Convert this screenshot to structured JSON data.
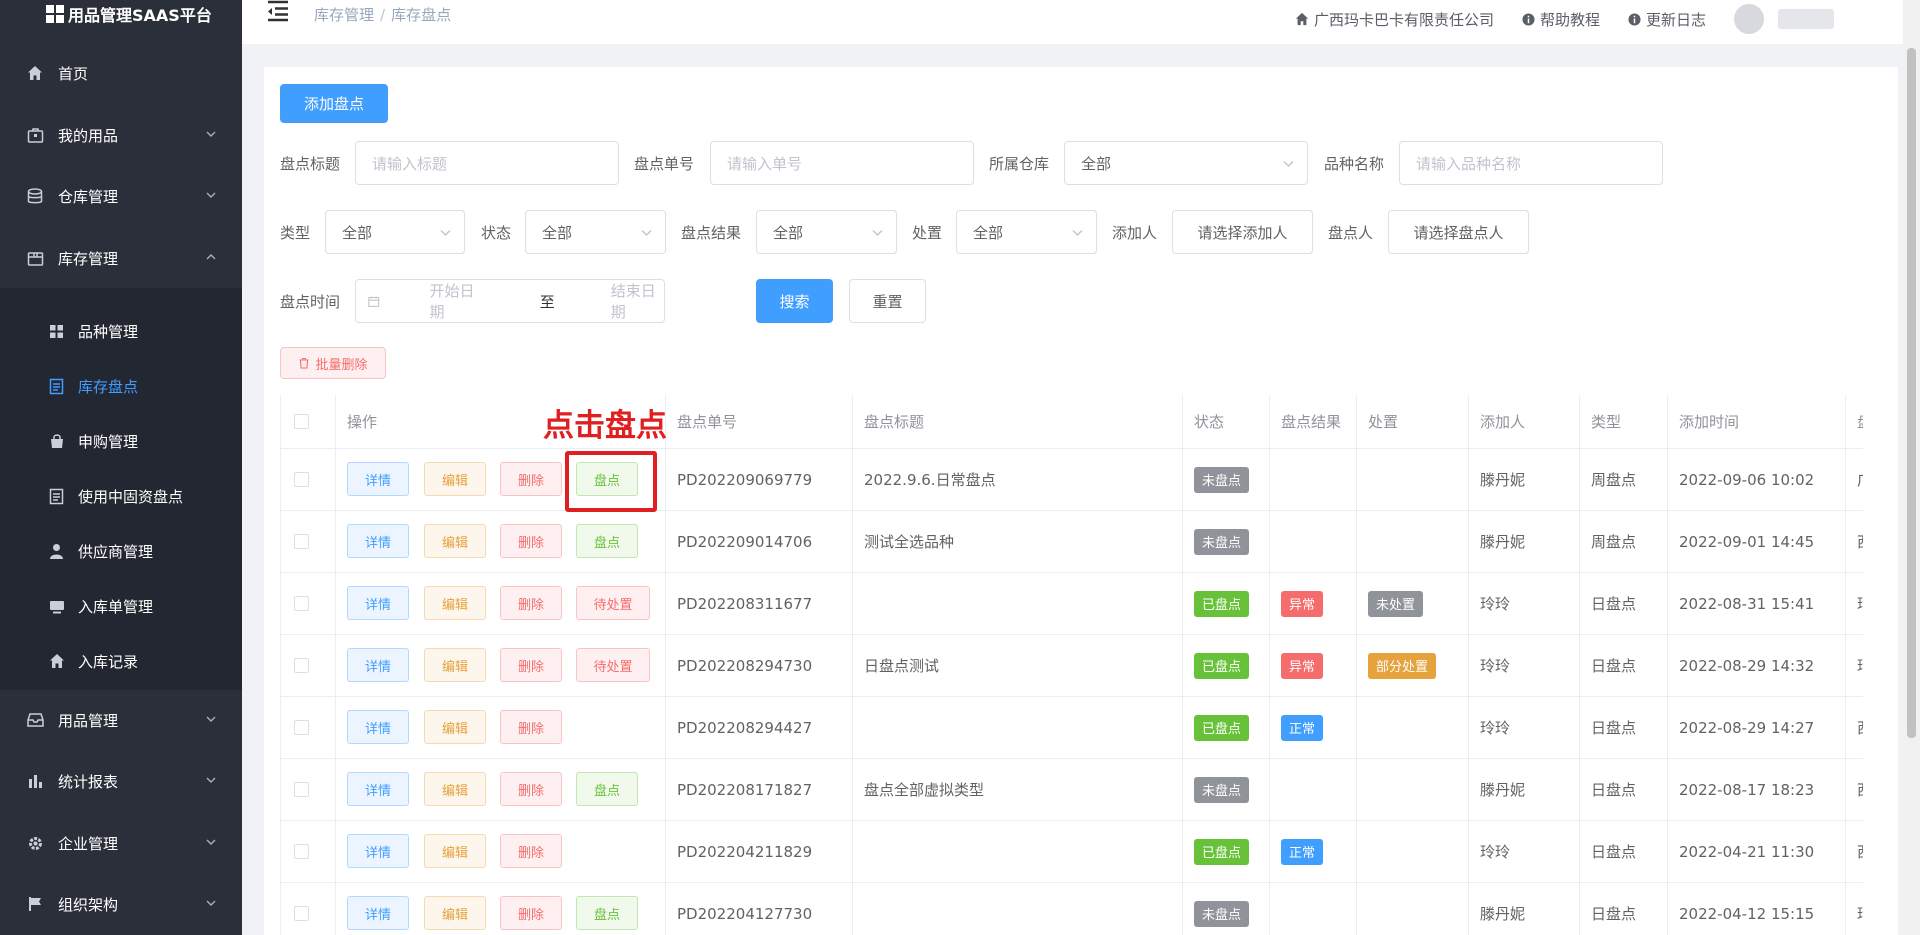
{
  "brand": {
    "title": "用品管理SAAS平台"
  },
  "sidebar": {
    "menus": [
      {
        "label": "首页",
        "icon": "home-icon"
      },
      {
        "label": "我的用品",
        "icon": "box-icon"
      },
      {
        "label": "仓库管理",
        "icon": "database-icon"
      },
      {
        "label": "库存管理",
        "icon": "package-icon"
      },
      {
        "label": "用品管理",
        "icon": "archive-icon"
      },
      {
        "label": "统计报表",
        "icon": "bar-chart-icon"
      },
      {
        "label": "企业管理",
        "icon": "gear-icon"
      },
      {
        "label": "组织架构",
        "icon": "flag-icon"
      }
    ],
    "submenus": [
      {
        "label": "品种管理",
        "icon": "grid-icon"
      },
      {
        "label": "库存盘点",
        "icon": "document-icon"
      },
      {
        "label": "申购管理",
        "icon": "shopping-bag-icon"
      },
      {
        "label": "使用中固资盘点",
        "icon": "document-icon"
      },
      {
        "label": "供应商管理",
        "icon": "user-icon"
      },
      {
        "label": "入库单管理",
        "icon": "tray-icon"
      },
      {
        "label": "入库记录",
        "icon": "home-icon"
      }
    ]
  },
  "header": {
    "breadcrumb": [
      "库存管理",
      "库存盘点"
    ],
    "separator": "/",
    "company": "广西玛卡巴卡有限责任公司",
    "help": "帮助教程",
    "changelog": "更新日志"
  },
  "toolbar": {
    "add_label": "添加盘点"
  },
  "filters": {
    "title_label": "盘点标题",
    "title_placeholder": "请输入标题",
    "no_label": "盘点单号",
    "no_placeholder": "请输入单号",
    "warehouse_label": "所属仓库",
    "warehouse_value": "全部",
    "variety_label": "品种名称",
    "variety_placeholder": "请输入品种名称",
    "type_label": "类型",
    "type_value": "全部",
    "status_label": "状态",
    "status_value": "全部",
    "result_label": "盘点结果",
    "result_value": "全部",
    "handle_label": "处置",
    "handle_value": "全部",
    "adder_label": "添加人",
    "adder_button": "请选择添加人",
    "checker_label": "盘点人",
    "checker_button": "请选择盘点人",
    "time_label": "盘点时间",
    "start_placeholder": "开始日期",
    "range_sep": "至",
    "end_placeholder": "结束日期",
    "search_label": "搜索",
    "reset_label": "重置"
  },
  "batch_delete_label": "批量删除",
  "annotation": {
    "text": "点击盘点"
  },
  "table": {
    "columns": [
      "操作",
      "盘点单号",
      "盘点标题",
      "状态",
      "盘点结果",
      "处置",
      "添加人",
      "类型",
      "添加时间",
      "盘"
    ],
    "action_labels": {
      "detail": "详情",
      "edit": "编辑",
      "delete": "删除"
    },
    "rows": [
      {
        "action": "盘点",
        "action_type": "check",
        "no": "PD202209069779",
        "title": "2022.9.6.日常盘点",
        "status": "未盘点",
        "status_color": "gray",
        "result": "",
        "result_color": "",
        "handle": "",
        "handle_color": "",
        "adder": "滕丹妮",
        "type": "周盘点",
        "time": "2022-09-06 10:02",
        "extra": "广"
      },
      {
        "action": "盘点",
        "action_type": "check",
        "no": "PD202209014706",
        "title": "测试全选品种",
        "status": "未盘点",
        "status_color": "gray",
        "result": "",
        "result_color": "",
        "handle": "",
        "handle_color": "",
        "adder": "滕丹妮",
        "type": "周盘点",
        "time": "2022-09-01 14:45",
        "extra": "西"
      },
      {
        "action": "待处置",
        "action_type": "pending",
        "no": "PD202208311677",
        "title": "",
        "status": "已盘点",
        "status_color": "green",
        "result": "异常",
        "result_color": "red",
        "handle": "未处置",
        "handle_color": "gray",
        "adder": "玲玲",
        "type": "日盘点",
        "time": "2022-08-31 15:41",
        "extra": "玲"
      },
      {
        "action": "待处置",
        "action_type": "pending",
        "no": "PD202208294730",
        "title": "日盘点测试",
        "status": "已盘点",
        "status_color": "green",
        "result": "异常",
        "result_color": "red",
        "handle": "部分处置",
        "handle_color": "orange",
        "adder": "玲玲",
        "type": "日盘点",
        "time": "2022-08-29 14:32",
        "extra": "玲"
      },
      {
        "action": "",
        "action_type": "none",
        "no": "PD202208294427",
        "title": "",
        "status": "已盘点",
        "status_color": "green",
        "result": "正常",
        "result_color": "blue",
        "handle": "",
        "handle_color": "",
        "adder": "玲玲",
        "type": "日盘点",
        "time": "2022-08-29 14:27",
        "extra": "西"
      },
      {
        "action": "盘点",
        "action_type": "check",
        "no": "PD202208171827",
        "title": "盘点全部虚拟类型",
        "status": "未盘点",
        "status_color": "gray",
        "result": "",
        "result_color": "",
        "handle": "",
        "handle_color": "",
        "adder": "滕丹妮",
        "type": "日盘点",
        "time": "2022-08-17 18:23",
        "extra": "西"
      },
      {
        "action": "",
        "action_type": "none",
        "no": "PD202204211829",
        "title": "",
        "status": "已盘点",
        "status_color": "green",
        "result": "正常",
        "result_color": "blue",
        "handle": "",
        "handle_color": "",
        "adder": "玲玲",
        "type": "日盘点",
        "time": "2022-04-21 11:30",
        "extra": "西"
      },
      {
        "action": "盘点",
        "action_type": "check",
        "no": "PD202204127730",
        "title": "",
        "status": "未盘点",
        "status_color": "gray",
        "result": "",
        "result_color": "",
        "handle": "",
        "handle_color": "",
        "adder": "滕丹妮",
        "type": "日盘点",
        "time": "2022-04-12 15:15",
        "extra": "玲"
      }
    ]
  }
}
